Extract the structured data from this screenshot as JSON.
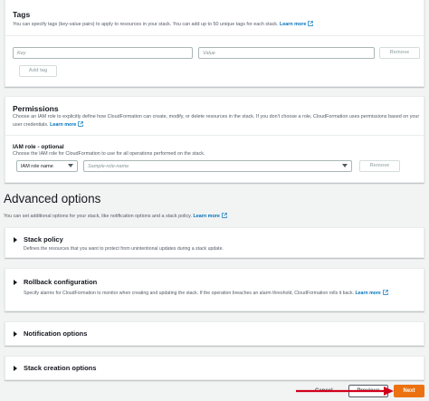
{
  "tags": {
    "title": "Tags",
    "description": "You can specify tags (key-value pairs) to apply to resources in your stack. You can add up to 50 unique tags for each stack.",
    "learn_more": "Learn more",
    "key_placeholder": "Key",
    "value_placeholder": "Value",
    "remove_label": "Remove",
    "add_tag_label": "Add tag"
  },
  "permissions": {
    "title": "Permissions",
    "description": "Choose an IAM role to explicitly define how CloudFormation can create, modify, or delete resources in the stack. If you don't choose a role, CloudFormation uses permissions based on your user credentials.",
    "learn_more": "Learn more",
    "iam_role_label": "IAM role - optional",
    "iam_role_help": "Choose the IAM role for CloudFormation to use for all operations performed on the stack.",
    "role_type_value": "IAM role name",
    "role_placeholder": "Sample-role-name",
    "remove_label": "Remove"
  },
  "advanced": {
    "title": "Advanced options",
    "description": "You can set additional options for your stack, like notification options and a stack policy.",
    "learn_more": "Learn more",
    "stack_policy": {
      "title": "Stack policy",
      "description": "Defines the resources that you want to protect from unintentional updates during a stack update."
    },
    "rollback": {
      "title": "Rollback configuration",
      "description": "Specify alarms for CloudFormation to monitor when creating and updating the stack. If the operation breaches an alarm threshold, CloudFormation rolls it back.",
      "learn_more": "Learn more"
    },
    "notification": {
      "title": "Notification options"
    },
    "stack_creation": {
      "title": "Stack creation options"
    }
  },
  "footer": {
    "cancel_label": "Cancel",
    "previous_label": "Previous",
    "next_label": "Next"
  },
  "colors": {
    "link": "#0073bb",
    "primary_button": "#ec7211",
    "annotation_arrow": "#d0021b"
  }
}
